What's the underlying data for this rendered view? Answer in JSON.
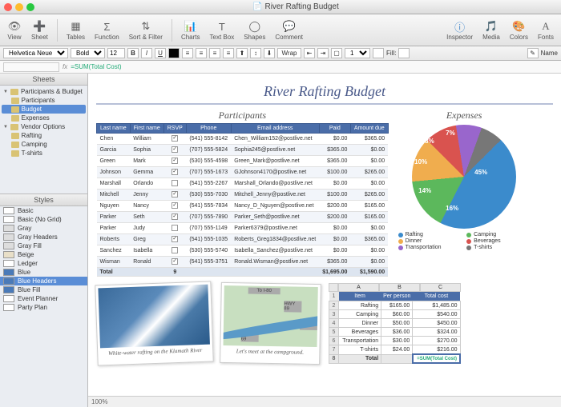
{
  "window": {
    "title": "River Rafting Budget",
    "doc_icon": "📄"
  },
  "toolbar": {
    "view": "View",
    "sheet": "Sheet",
    "tables": "Tables",
    "function": "Function",
    "sort": "Sort & Filter",
    "charts": "Charts",
    "textbox": "Text Box",
    "shapes": "Shapes",
    "comment": "Comment",
    "inspector": "Inspector",
    "media": "Media",
    "colors": "Colors",
    "fonts": "Fonts"
  },
  "format": {
    "font": "Helvetica Neue",
    "style": "Bold",
    "size": "12",
    "wrap": "Wrap",
    "pt": "1 pt",
    "fill": "Fill:",
    "name": "Name"
  },
  "formula": {
    "label": "fx",
    "value": "=SUM(Total Cost)"
  },
  "sidebar": {
    "sheets_label": "Sheets",
    "items": [
      {
        "label": "Participants & Budget",
        "type": "sheet",
        "expanded": true
      },
      {
        "label": "Participants",
        "type": "table"
      },
      {
        "label": "Budget",
        "type": "table",
        "selected": true
      },
      {
        "label": "Expenses",
        "type": "table"
      },
      {
        "label": "Vendor Options",
        "type": "sheet",
        "expanded": true
      },
      {
        "label": "Rafting",
        "type": "table"
      },
      {
        "label": "Camping",
        "type": "table"
      },
      {
        "label": "T-shirts",
        "type": "table"
      }
    ],
    "styles_label": "Styles",
    "styles": [
      {
        "label": "Basic"
      },
      {
        "label": "Basic (No Grid)"
      },
      {
        "label": "Gray"
      },
      {
        "label": "Gray Headers"
      },
      {
        "label": "Gray Fill"
      },
      {
        "label": "Beige"
      },
      {
        "label": "Ledger"
      },
      {
        "label": "Blue"
      },
      {
        "label": "Blue Headers",
        "selected": true
      },
      {
        "label": "Blue Fill"
      },
      {
        "label": "Event Planner"
      },
      {
        "label": "Party Plan"
      }
    ]
  },
  "doc": {
    "title": "River Rafting Budget",
    "participants_title": "Participants",
    "cols": [
      "Last name",
      "First name",
      "RSVP",
      "Phone",
      "Email address",
      "Paid",
      "Amount due"
    ],
    "rows": [
      [
        "Chen",
        "William",
        true,
        "(541) 555-8142",
        "Chen_William152@postlive.net",
        "$0.00",
        "$365.00"
      ],
      [
        "Garcia",
        "Sophia",
        true,
        "(707) 555-5824",
        "Sophia245@postlive.net",
        "$365.00",
        "$0.00"
      ],
      [
        "Green",
        "Mark",
        true,
        "(530) 555-4598",
        "Green_Mark@postlive.net",
        "$365.00",
        "$0.00"
      ],
      [
        "Johnson",
        "Gemma",
        true,
        "(707) 555-1673",
        "GJohnson4170@postlive.net",
        "$100.00",
        "$265.00"
      ],
      [
        "Marshall",
        "Orlando",
        false,
        "(541) 555-2267",
        "Marshall_Orlando@postlive.net",
        "$0.00",
        "$0.00"
      ],
      [
        "Mitchell",
        "Jenny",
        true,
        "(530) 555-7030",
        "Mitchell_Jenny@postlive.net",
        "$100.00",
        "$265.00"
      ],
      [
        "Nguyen",
        "Nancy",
        true,
        "(541) 555-7834",
        "Nancy_D_Nguyen@postlive.net",
        "$200.00",
        "$165.00"
      ],
      [
        "Parker",
        "Seth",
        true,
        "(707) 555-7890",
        "Parker_Seth@postlive.net",
        "$200.00",
        "$165.00"
      ],
      [
        "Parker",
        "Judy",
        false,
        "(707) 555-1149",
        "Parker6379@postlive.net",
        "$0.00",
        "$0.00"
      ],
      [
        "Roberts",
        "Greg",
        true,
        "(541) 555-1035",
        "Roberts_Greg1834@postlive.net",
        "$0.00",
        "$365.00"
      ],
      [
        "Sanchez",
        "Isabella",
        false,
        "(530) 555-5740",
        "Isabella_Sanchez@postlive.net",
        "$0.00",
        "$0.00"
      ],
      [
        "Wisman",
        "Ronald",
        true,
        "(541) 555-3751",
        "Ronald.Wisman@postlive.net",
        "$365.00",
        "$0.00"
      ]
    ],
    "total_label": "Total",
    "total_rsvp": "9",
    "total_paid": "$1,695.00",
    "total_due": "$1,590.00",
    "expenses_title": "Expenses",
    "legend": [
      {
        "label": "Rafting",
        "color": "#3b8bcc"
      },
      {
        "label": "Camping",
        "color": "#5cb85c"
      },
      {
        "label": "Dinner",
        "color": "#f0ad4e"
      },
      {
        "label": "Beverages",
        "color": "#d9534f"
      },
      {
        "label": "Transportation",
        "color": "#9966cc"
      },
      {
        "label": "T-shirts",
        "color": "#777"
      }
    ],
    "photo_caption": "White-water rafting on the Klamath River",
    "map_caption": "Let's meet at the campground.",
    "map_labels": {
      "to80": "To I-80",
      "hwy89": "HWY 89",
      "hwy49": "HWY 49",
      "hwy69": "HWY 69"
    },
    "budget_cols": [
      "Item",
      "Per person",
      "Total cost"
    ],
    "budget_rows": [
      [
        "Rafting",
        "$165.00",
        "$1,485.00"
      ],
      [
        "Camping",
        "$60.00",
        "$540.00"
      ],
      [
        "Dinner",
        "$50.00",
        "$450.00"
      ],
      [
        "Beverages",
        "$36.00",
        "$324.00"
      ],
      [
        "Transportation",
        "$30.00",
        "$270.00"
      ],
      [
        "T-shirts",
        "$24.00",
        "$216.00"
      ]
    ],
    "budget_total": "Total",
    "budget_formula": "=SUM(Total Cost)",
    "grid_cols": [
      "A",
      "B",
      "C"
    ]
  },
  "status": {
    "zoom": "100%"
  },
  "chart_data": {
    "type": "pie",
    "title": "Expenses",
    "series": [
      {
        "name": "Rafting",
        "value": 45,
        "color": "#3b8bcc"
      },
      {
        "name": "Camping",
        "value": 16,
        "color": "#5cb85c"
      },
      {
        "name": "Dinner",
        "value": 14,
        "color": "#f0ad4e"
      },
      {
        "name": "Beverages",
        "value": 10,
        "color": "#d9534f"
      },
      {
        "name": "Transportation",
        "value": 8,
        "color": "#9966cc"
      },
      {
        "name": "T-shirts",
        "value": 7,
        "color": "#777"
      }
    ]
  }
}
